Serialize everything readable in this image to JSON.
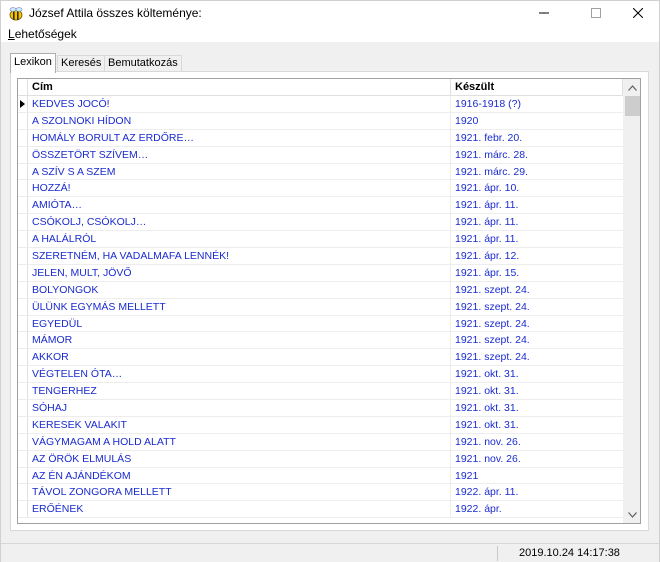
{
  "window": {
    "title": "József Attila összes költeménye:",
    "controls": {
      "minimize": "—",
      "maximize": "☐",
      "close": "✕"
    },
    "icon": "bee-icon"
  },
  "menu": {
    "items": [
      {
        "accel": "L",
        "rest": "ehetőségek"
      }
    ]
  },
  "tabs": [
    {
      "label": "Lexikon",
      "active": true
    },
    {
      "label": "Keresés",
      "active": false
    },
    {
      "label": "Bemutatkozás",
      "active": false
    }
  ],
  "grid": {
    "columns": [
      "Cím",
      "Készült"
    ],
    "rows": [
      {
        "title": "KEDVES JOCÓ!",
        "date": "1916-1918 (?)"
      },
      {
        "title": "A SZOLNOKI HÍDON",
        "date": "1920"
      },
      {
        "title": "HOMÁLY BORULT AZ ERDŐRE…",
        "date": "1921. febr. 20."
      },
      {
        "title": "ÖSSZETÖRT SZÍVEM…",
        "date": "1921. márc. 28."
      },
      {
        "title": "A SZÍV S A SZEM",
        "date": "1921. márc. 29."
      },
      {
        "title": "HOZZÁ!",
        "date": "1921. ápr. 10."
      },
      {
        "title": "AMIÓTA…",
        "date": "1921. ápr. 11."
      },
      {
        "title": "CSÓKOLJ, CSÓKOLJ…",
        "date": "1921. ápr. 11."
      },
      {
        "title": "A HALÁLRÓL",
        "date": "1921. ápr. 11."
      },
      {
        "title": "SZERETNÉM, HA VADALMAFA LENNÉK!",
        "date": "1921. ápr. 12."
      },
      {
        "title": "JELEN, MULT, JÖVŐ",
        "date": "1921. ápr. 15."
      },
      {
        "title": "BOLYONGOK",
        "date": "1921. szept. 24."
      },
      {
        "title": "ÜLÜNK EGYMÁS MELLETT",
        "date": "1921. szept. 24."
      },
      {
        "title": "EGYEDÜL",
        "date": "1921. szept. 24."
      },
      {
        "title": "MÁMOR",
        "date": "1921. szept. 24."
      },
      {
        "title": "AKKOR",
        "date": "1921. szept. 24."
      },
      {
        "title": "VÉGTELEN ÓTA…",
        "date": "1921. okt. 31."
      },
      {
        "title": "TENGERHEZ",
        "date": "1921. okt. 31."
      },
      {
        "title": "SÓHAJ",
        "date": "1921. okt. 31."
      },
      {
        "title": "KERESEK VALAKIT",
        "date": "1921. okt. 31."
      },
      {
        "title": "VÁGYMAGAM A HOLD ALATT",
        "date": "1921. nov. 26."
      },
      {
        "title": "AZ ÖRÖK ELMULÁS",
        "date": "1921. nov. 26."
      },
      {
        "title": "AZ ÉN AJÁNDÉKOM",
        "date": "1921"
      },
      {
        "title": "TÁVOL ZONGORA MELLETT",
        "date": "1922. ápr. 11."
      },
      {
        "title": "ERŐÉNEK",
        "date": "1922. ápr."
      }
    ],
    "selected_row": 0,
    "text_color": "#1a2bd0"
  },
  "status": {
    "datetime": "2019.10.24 14:17:38"
  }
}
